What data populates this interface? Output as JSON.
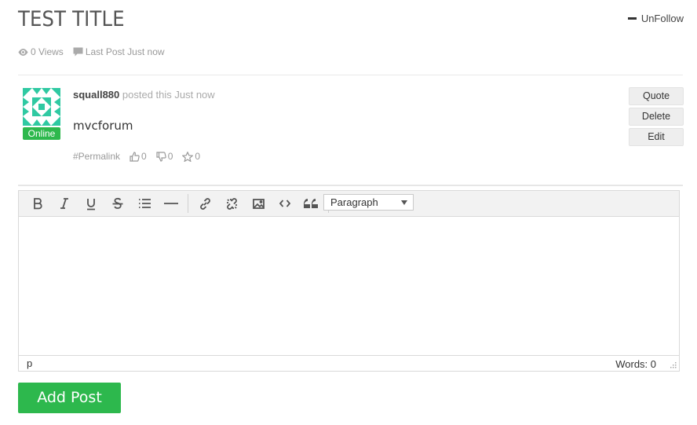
{
  "topic": {
    "title": "TEST TITLE",
    "unfollow_label": "UnFollow"
  },
  "meta": {
    "views": "0 Views",
    "last_post": "Last Post Just now"
  },
  "post": {
    "username": "squall880",
    "posted_text": "posted this Just now",
    "status": "Online",
    "content": "mvcforum",
    "permalink": "#Permalink",
    "upvotes": "0",
    "downvotes": "0",
    "favourites": "0"
  },
  "side_buttons": {
    "quote": "Quote",
    "delete": "Delete",
    "edit": "Edit"
  },
  "editor": {
    "format_select": "Paragraph",
    "path": "p",
    "word_count": "Words: 0",
    "icons": [
      "bold-icon",
      "italic-icon",
      "underline-icon",
      "strikethrough-icon",
      "bullet-list-icon",
      "horizontal-rule-icon",
      "link-icon",
      "unlink-icon",
      "image-icon",
      "code-icon",
      "blockquote-icon"
    ]
  },
  "actions": {
    "add_post": "Add Post"
  },
  "colors": {
    "accent": "#2db84d",
    "avatar": "#2fc9a2"
  }
}
